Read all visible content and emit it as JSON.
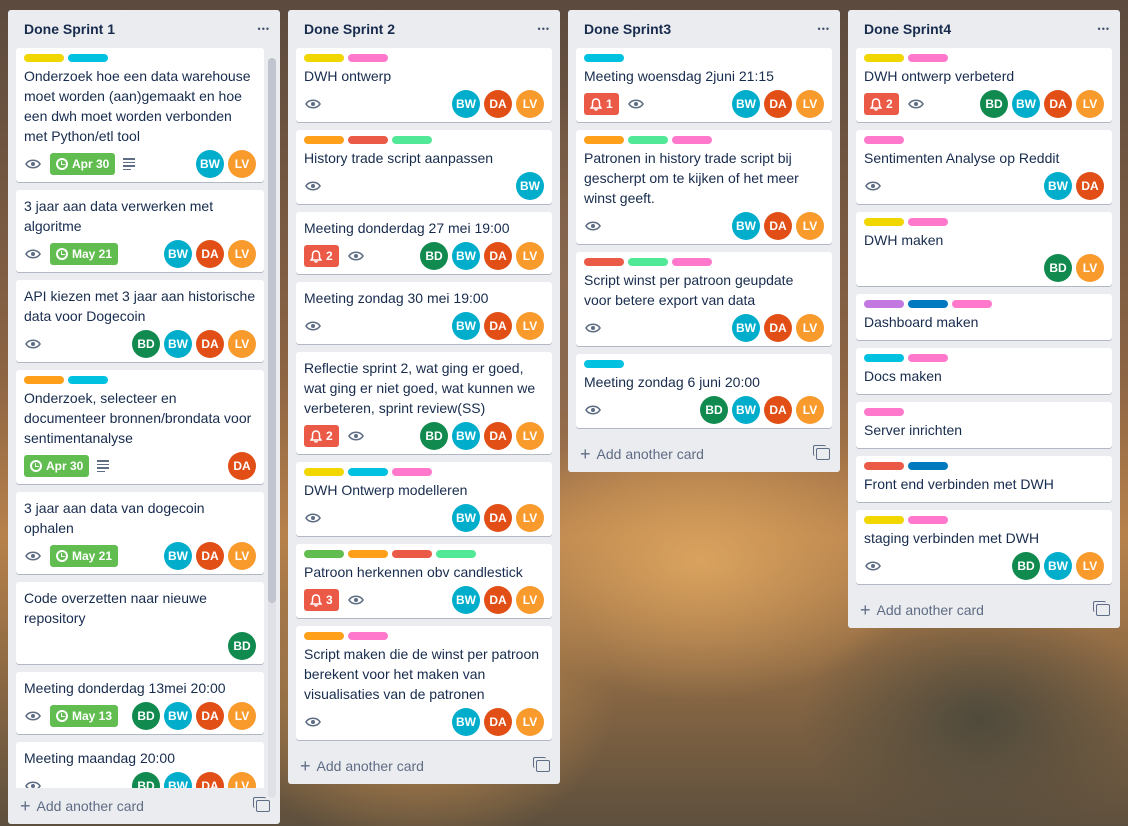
{
  "colors": {
    "yellow": "#f2d600",
    "cyan": "#00c2e0",
    "orange": "#ff9f1a",
    "red": "#eb5a46",
    "green": "#51e898",
    "pink": "#ff78cb",
    "purple": "#c377e0",
    "blue": "#0079bf",
    "lime": "#61bd4f"
  },
  "members": {
    "BW": "#00aecc",
    "LV": "#f99a2d",
    "DA": "#e14e16",
    "BD": "#108a4f"
  },
  "add_card_label": "Add another card",
  "lists": [
    {
      "title": "Done Sprint 1",
      "cards": [
        {
          "labels": [
            "yellow",
            "cyan"
          ],
          "title": "Onderzoek hoe een data warehouse moet worden (aan)gemaakt en hoe een dwh moet worden verbonden met Python/etl tool",
          "watch": true,
          "due": "Apr 30",
          "desc": true,
          "members": [
            "BW",
            "LV"
          ]
        },
        {
          "labels": [],
          "title": "3 jaar aan data verwerken met algoritme",
          "watch": true,
          "due": "May 21",
          "members": [
            "BW",
            "DA",
            "LV"
          ]
        },
        {
          "labels": [],
          "title": "API kiezen met 3 jaar aan historische data voor Dogecoin",
          "watch": true,
          "members": [
            "BD",
            "BW",
            "DA",
            "LV"
          ]
        },
        {
          "labels": [
            "orange",
            "cyan"
          ],
          "title": "Onderzoek, selecteer en documenteer bronnen/brondata voor sentimentanalyse",
          "due": "Apr 30",
          "desc": true,
          "members": [
            "DA"
          ]
        },
        {
          "labels": [],
          "title": "3 jaar aan data van dogecoin ophalen",
          "watch": true,
          "due": "May 21",
          "members": [
            "BW",
            "DA",
            "LV"
          ]
        },
        {
          "labels": [],
          "title": "Code overzetten naar nieuwe repository",
          "members": [
            "BD"
          ]
        },
        {
          "labels": [],
          "title": "Meeting donderdag 13mei 20:00",
          "watch": true,
          "due": "May 13",
          "members": [
            "BD",
            "BW",
            "DA",
            "LV"
          ]
        },
        {
          "labels": [],
          "title": "Meeting maandag 20:00",
          "watch": true,
          "members": [
            "BD",
            "BW",
            "DA",
            "LV"
          ]
        }
      ]
    },
    {
      "title": "Done Sprint 2",
      "cards": [
        {
          "labels": [
            "yellow",
            "pink"
          ],
          "title": "DWH ontwerp",
          "watch": true,
          "members": [
            "BW",
            "DA",
            "LV"
          ]
        },
        {
          "labels": [
            "orange",
            "red",
            "green"
          ],
          "title": "History trade script aanpassen",
          "watch": true,
          "members": [
            "BW"
          ]
        },
        {
          "labels": [],
          "title": "Meeting donderdag 27 mei 19:00",
          "notif": "2",
          "watch": true,
          "members": [
            "BD",
            "BW",
            "DA",
            "LV"
          ]
        },
        {
          "labels": [],
          "title": "Meeting zondag 30 mei 19:00",
          "watch": true,
          "members": [
            "BW",
            "DA",
            "LV"
          ]
        },
        {
          "labels": [],
          "title": "Reflectie sprint 2, wat ging er goed, wat ging er niet goed, wat kunnen we verbeteren, sprint review(SS)",
          "notif": "2",
          "watch": true,
          "members": [
            "BD",
            "BW",
            "DA",
            "LV"
          ]
        },
        {
          "labels": [
            "yellow",
            "cyan",
            "pink"
          ],
          "title": "DWH Ontwerp modelleren",
          "watch": true,
          "members": [
            "BW",
            "DA",
            "LV"
          ]
        },
        {
          "labels": [
            "lime",
            "orange",
            "red",
            "green"
          ],
          "title": "Patroon herkennen obv candlestick",
          "notif": "3",
          "watch": true,
          "members": [
            "BW",
            "DA",
            "LV"
          ]
        },
        {
          "labels": [
            "orange",
            "pink"
          ],
          "title": "Script maken die de winst per patroon berekent voor het maken van visualisaties van de patronen",
          "watch": true,
          "members": [
            "BW",
            "DA",
            "LV"
          ]
        }
      ]
    },
    {
      "title": "Done Sprint3",
      "cards": [
        {
          "labels": [
            "cyan"
          ],
          "title": "Meeting woensdag 2juni 21:15",
          "notif": "1",
          "watch": true,
          "members": [
            "BW",
            "DA",
            "LV"
          ]
        },
        {
          "labels": [
            "orange",
            "green",
            "pink"
          ],
          "title": "Patronen in history trade script bij gescherpt om te kijken of het meer winst geeft.",
          "watch": true,
          "members": [
            "BW",
            "DA",
            "LV"
          ]
        },
        {
          "labels": [
            "red",
            "green",
            "pink"
          ],
          "title": "Script winst per patroon geupdate voor betere export van data",
          "watch": true,
          "members": [
            "BW",
            "DA",
            "LV"
          ]
        },
        {
          "labels": [
            "cyan"
          ],
          "title": "Meeting zondag 6 juni 20:00",
          "watch": true,
          "members": [
            "BD",
            "BW",
            "DA",
            "LV"
          ]
        }
      ]
    },
    {
      "title": "Done Sprint4",
      "cards": [
        {
          "labels": [
            "yellow",
            "pink"
          ],
          "title": "DWH ontwerp verbeterd",
          "notif": "2",
          "watch": true,
          "members": [
            "BD",
            "BW",
            "DA",
            "LV"
          ]
        },
        {
          "labels": [
            "pink"
          ],
          "title": "Sentimenten Analyse op Reddit",
          "watch": true,
          "members": [
            "BW",
            "DA"
          ]
        },
        {
          "labels": [
            "yellow",
            "pink"
          ],
          "title": "DWH maken",
          "members": [
            "BD",
            "LV"
          ]
        },
        {
          "labels": [
            "purple",
            "blue",
            "pink"
          ],
          "title": "Dashboard maken",
          "members": []
        },
        {
          "labels": [
            "cyan",
            "pink"
          ],
          "title": "Docs maken",
          "members": []
        },
        {
          "labels": [
            "pink"
          ],
          "title": "Server inrichten",
          "members": []
        },
        {
          "labels": [
            "red",
            "blue"
          ],
          "title": "Front end verbinden met DWH",
          "members": []
        },
        {
          "labels": [
            "yellow",
            "pink"
          ],
          "title": "staging verbinden met DWH",
          "watch": true,
          "members": [
            "BD",
            "BW",
            "LV"
          ]
        }
      ]
    }
  ]
}
